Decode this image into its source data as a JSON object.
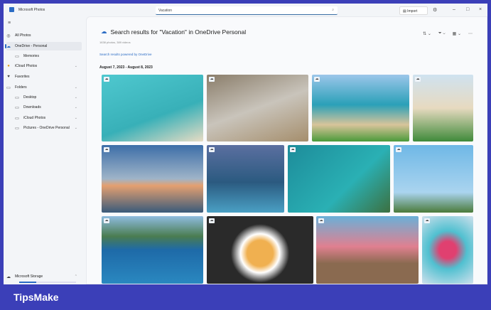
{
  "window": {
    "title": "Microsoft Photos",
    "search_value": "Vacation",
    "import_label": "Import"
  },
  "sidebar": {
    "items": [
      {
        "label": "All Photos",
        "icon": "photos-icon"
      },
      {
        "label": "OneDrive - Personal",
        "icon": "cloud-icon",
        "selected": true
      },
      {
        "label": "Memories",
        "icon": "memories-icon"
      },
      {
        "label": "iCloud Photos",
        "icon": "icloud-icon"
      },
      {
        "label": "Favorites",
        "icon": "heart-icon"
      },
      {
        "label": "Folders",
        "icon": "folder-icon"
      },
      {
        "label": "Desktop",
        "icon": "folder-icon"
      },
      {
        "label": "Downloads",
        "icon": "folder-icon"
      },
      {
        "label": "iCloud Photos",
        "icon": "folder-icon"
      },
      {
        "label": "Pictures - OneDrive Personal",
        "icon": "folder-icon"
      }
    ],
    "storage_label": "Microsoft Storage"
  },
  "main": {
    "title": "Search results for \"Vacation\" in OneDrive Personal",
    "subtitle": "1638 photos, 389 videos",
    "powered": "Search results powered by OneDrive",
    "date_range": "August 7, 2023 - August 8, 2023"
  },
  "watermark": "TipsMake",
  "colors": {
    "accent": "#2b6cc4",
    "frame": "#3b3fb8"
  }
}
